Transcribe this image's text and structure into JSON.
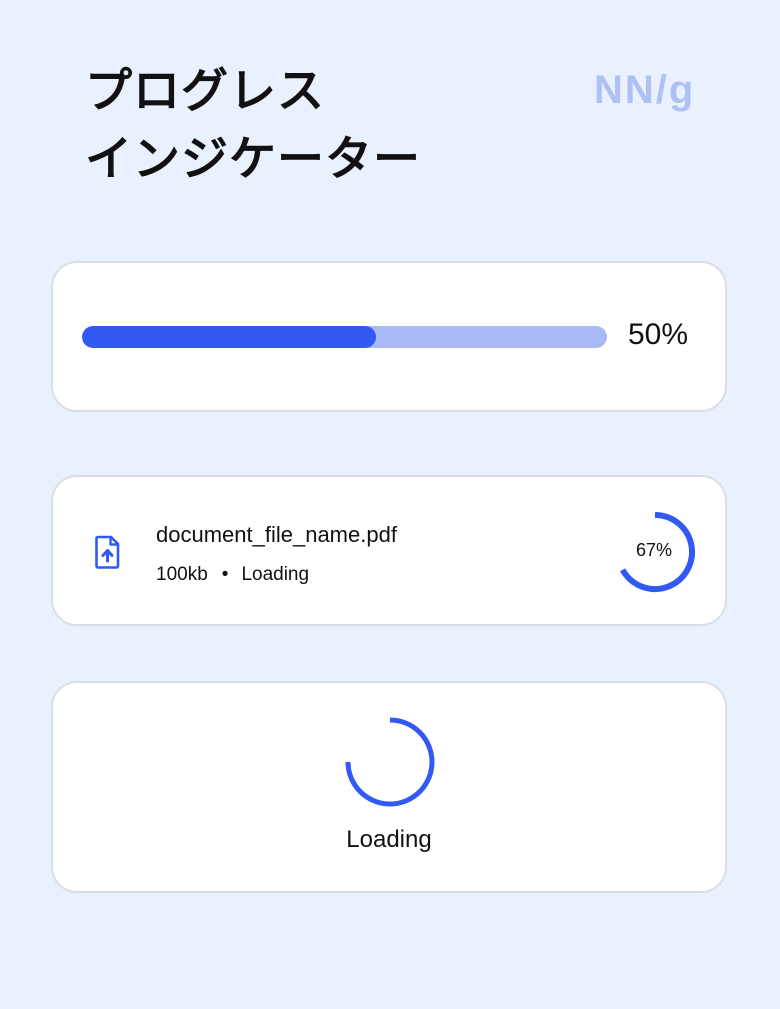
{
  "title": {
    "line1": "プログレス",
    "line2": "インジケーター"
  },
  "logo": "NN/g",
  "colors": {
    "accent": "#3359f5",
    "track": "#a9b9f6",
    "background": "#eaf1fe",
    "logo": "#aec0f6"
  },
  "bar_indicator": {
    "percent_label": "50%",
    "fill_fraction": 0.56
  },
  "file_upload": {
    "icon": "file-upload-icon",
    "file_name": "document_file_name.pdf",
    "size": "100kb",
    "separator": "•",
    "status": "Loading",
    "percent_label": "67%",
    "progress_fraction": 0.67
  },
  "spinner": {
    "label": "Loading",
    "arc_fraction": 0.75
  }
}
